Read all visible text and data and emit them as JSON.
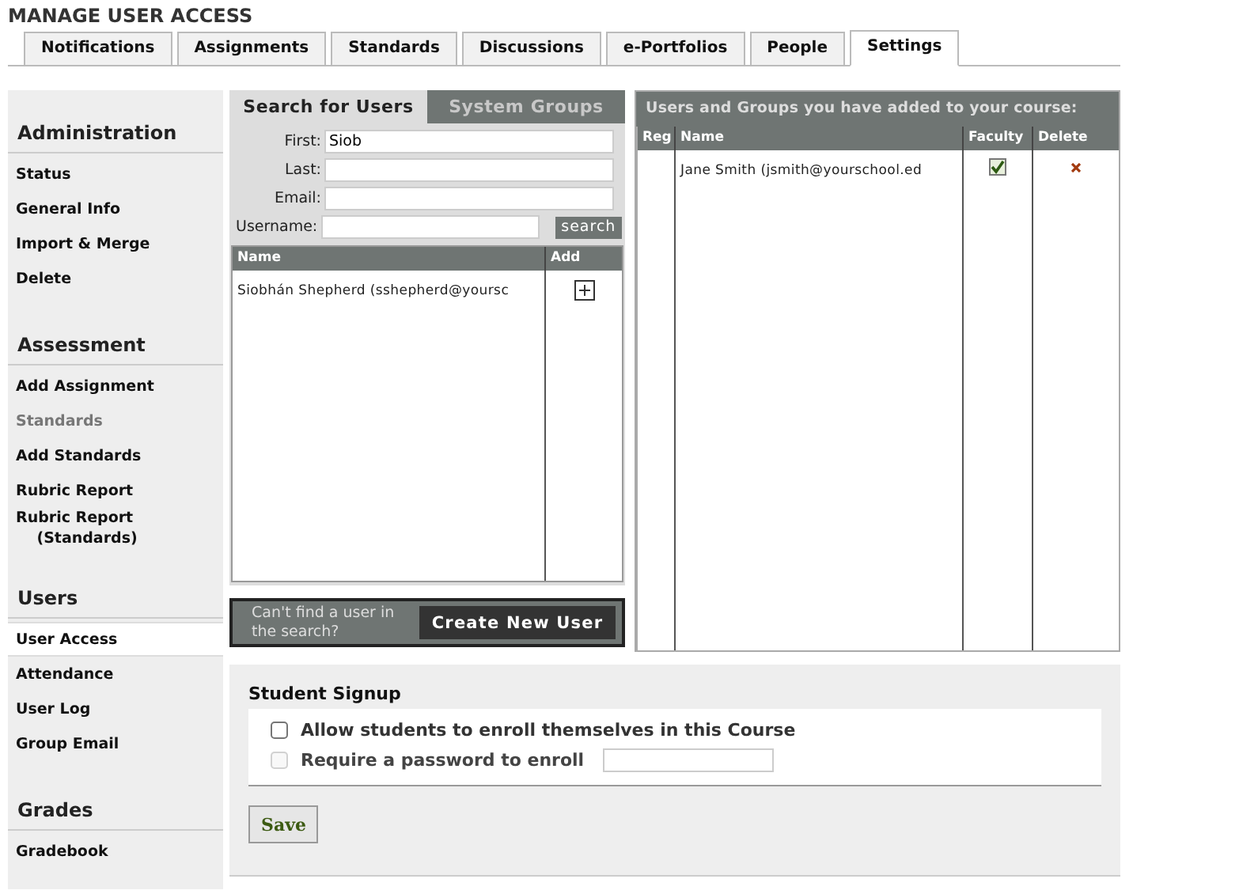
{
  "page_title": "MANAGE USER ACCESS",
  "tabs": [
    {
      "label": "Notifications",
      "selected": false
    },
    {
      "label": "Assignments",
      "selected": false
    },
    {
      "label": "Standards",
      "selected": false
    },
    {
      "label": "Discussions",
      "selected": false
    },
    {
      "label": "e-Portfolios",
      "selected": false
    },
    {
      "label": "People",
      "selected": false
    },
    {
      "label": "Settings",
      "selected": true
    }
  ],
  "sidebar": [
    {
      "heading": "Administration",
      "items": [
        {
          "label": "Status",
          "selected": false,
          "disabled": false
        },
        {
          "label": "General Info",
          "selected": false,
          "disabled": false
        },
        {
          "label": "Import & Merge",
          "selected": false,
          "disabled": false
        },
        {
          "label": "Delete",
          "selected": false,
          "disabled": false
        }
      ]
    },
    {
      "heading": "Assessment",
      "items": [
        {
          "label": "Add Assignment",
          "selected": false,
          "disabled": false
        },
        {
          "label": "Standards",
          "selected": false,
          "disabled": true
        },
        {
          "label": "Add Standards",
          "selected": false,
          "disabled": false
        },
        {
          "label": "Rubric Report",
          "selected": false,
          "disabled": false
        },
        {
          "label": "Rubric Report\n(Standards)",
          "selected": false,
          "disabled": false
        }
      ]
    },
    {
      "heading": "Users",
      "items": [
        {
          "label": "User Access",
          "selected": true,
          "disabled": false
        },
        {
          "label": "Attendance",
          "selected": false,
          "disabled": false
        },
        {
          "label": "User Log",
          "selected": false,
          "disabled": false
        },
        {
          "label": "Group Email",
          "selected": false,
          "disabled": false
        }
      ]
    },
    {
      "heading": "Grades",
      "items": [
        {
          "label": "Gradebook",
          "selected": false,
          "disabled": false
        }
      ]
    }
  ],
  "search_panel": {
    "tabs": [
      {
        "label": "Search for Users",
        "selected": true
      },
      {
        "label": "System Groups",
        "selected": false
      }
    ],
    "fields": [
      {
        "label": "First:",
        "value": "Siob"
      },
      {
        "label": "Last:"
      },
      {
        "label": "Email:"
      },
      {
        "label": "Username:"
      }
    ],
    "search_button": "search",
    "columns": [
      "Name",
      "Add"
    ],
    "rows": [
      {
        "name": "Siobhán Shepherd (sshepherd@yoursc"
      }
    ],
    "prompt": "Can't find a user in the search?",
    "create_button": "Create New User"
  },
  "course_panel": {
    "title": "Users and Groups you have added to your course:",
    "columns": [
      "Reg",
      "Name",
      "Faculty",
      "Delete"
    ],
    "rows": [
      {
        "name": "Jane Smith (jsmith@yourschool.ed",
        "faculty": true
      }
    ]
  },
  "signup": {
    "heading": "Student Signup",
    "options": [
      {
        "label": "Allow students to enroll themselves in this Course",
        "checked": false,
        "disabled": false
      },
      {
        "label": "Require a password to enroll",
        "checked": false,
        "disabled": true
      }
    ],
    "save_button": "Save"
  }
}
